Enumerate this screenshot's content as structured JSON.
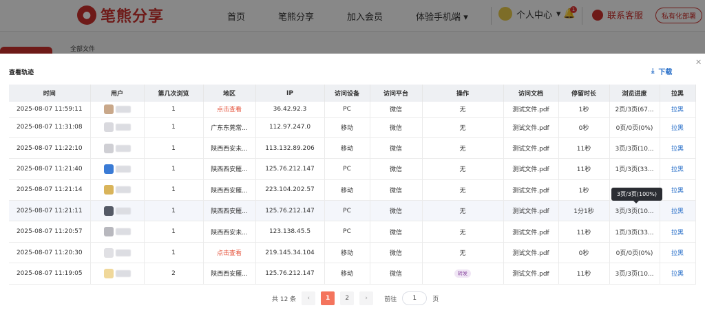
{
  "nav": {
    "logo_text": "笔熊分享",
    "items": [
      "首页",
      "笔熊分享",
      "加入会员",
      "体验手机端"
    ],
    "user_center": "个人中心",
    "bell_count": "1",
    "service": "联系客服",
    "private_deploy": "私有化部署"
  },
  "breadcrumb": "全部文件",
  "modal": {
    "title": "查看轨迹",
    "download": "下载",
    "columns": [
      "时间",
      "用户",
      "第几次浏览",
      "地区",
      "IP",
      "访问设备",
      "访问平台",
      "操作",
      "访问文档",
      "停留时长",
      "浏览进度",
      "拉黑"
    ],
    "rows": [
      {
        "time": "2025-08-07 11:59:11",
        "visit": "1",
        "region": "点击查看",
        "ip": "36.42.92.3",
        "device": "PC",
        "platform": "微信",
        "action": "无",
        "doc": "测试文件.pdf",
        "stay": "1秒",
        "progress": "2页/3页(67...",
        "block": "拉黑"
      },
      {
        "time": "2025-08-07 11:31:08",
        "visit": "1",
        "region": "广东东莞常...",
        "ip": "112.97.247.0",
        "device": "移动",
        "platform": "微信",
        "action": "无",
        "doc": "测试文件.pdf",
        "stay": "0秒",
        "progress": "0页/0页(0%)",
        "block": "拉黑"
      },
      {
        "time": "2025-08-07 11:22:10",
        "visit": "1",
        "region": "陕西西安未...",
        "ip": "113.132.89.206",
        "device": "移动",
        "platform": "微信",
        "action": "无",
        "doc": "测试文件.pdf",
        "stay": "11秒",
        "progress": "3页/3页(10...",
        "block": "拉黑"
      },
      {
        "time": "2025-08-07 11:21:40",
        "visit": "1",
        "region": "陕西西安雁...",
        "ip": "125.76.212.147",
        "device": "PC",
        "platform": "微信",
        "action": "无",
        "doc": "测试文件.pdf",
        "stay": "11秒",
        "progress": "1页/3页(33...",
        "block": "拉黑"
      },
      {
        "time": "2025-08-07 11:21:14",
        "visit": "1",
        "region": "陕西西安雁...",
        "ip": "223.104.202.57",
        "device": "移动",
        "platform": "微信",
        "action": "无",
        "doc": "测试文件.pdf",
        "stay": "1秒",
        "progress": "",
        "block": "拉黑"
      },
      {
        "time": "2025-08-07 11:21:11",
        "visit": "1",
        "region": "陕西西安雁...",
        "ip": "125.76.212.147",
        "device": "PC",
        "platform": "微信",
        "action": "无",
        "doc": "测试文件.pdf",
        "stay": "1分1秒",
        "progress": "3页/3页(10...",
        "block": "拉黑"
      },
      {
        "time": "2025-08-07 11:20:57",
        "visit": "1",
        "region": "陕西西安未...",
        "ip": "123.138.45.5",
        "device": "PC",
        "platform": "微信",
        "action": "无",
        "doc": "测试文件.pdf",
        "stay": "11秒",
        "progress": "1页/3页(33...",
        "block": "拉黑"
      },
      {
        "time": "2025-08-07 11:20:30",
        "visit": "1",
        "region": "点击查看",
        "ip": "219.145.34.104",
        "device": "移动",
        "platform": "微信",
        "action": "无",
        "doc": "测试文件.pdf",
        "stay": "0秒",
        "progress": "0页/0页(0%)",
        "block": "拉黑"
      },
      {
        "time": "2025-08-07 11:19:05",
        "visit": "2",
        "region": "陕西西安雁...",
        "ip": "125.76.212.147",
        "device": "移动",
        "platform": "微信",
        "action": "转发",
        "doc": "测试文件.pdf",
        "stay": "11秒",
        "progress": "3页/3页(10...",
        "block": "拉黑"
      }
    ],
    "tooltip": "3页/3页(100%)"
  },
  "pager": {
    "total": "共 12 条",
    "pages": [
      "1",
      "2"
    ],
    "goto_label": "前往",
    "goto_value": "1",
    "page_suffix": "页"
  },
  "colors": {
    "brand": "#c9302c",
    "accent": "#f4745d",
    "link": "#2a70c9"
  }
}
